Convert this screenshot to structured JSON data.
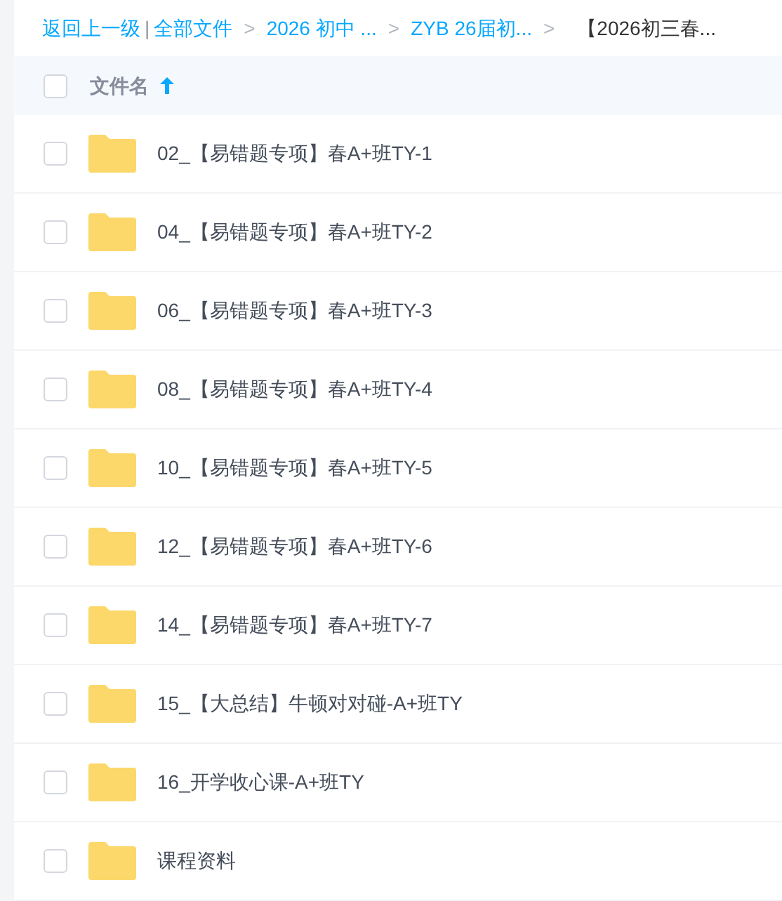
{
  "breadcrumb": {
    "back": "返回上一级",
    "divider": "|",
    "items": [
      {
        "label": "全部文件",
        "current": false
      },
      {
        "label": "2026 初中 ...",
        "current": false
      },
      {
        "label": "ZYB 26届初...",
        "current": false
      },
      {
        "label": "【2026初三春...",
        "current": true
      }
    ],
    "separator": ">"
  },
  "header": {
    "checked": false,
    "column": "文件名"
  },
  "files": [
    {
      "name": "02_【易错题专项】春A+班TY-1",
      "checked": false
    },
    {
      "name": "04_【易错题专项】春A+班TY-2",
      "checked": false
    },
    {
      "name": "06_【易错题专项】春A+班TY-3",
      "checked": false
    },
    {
      "name": "08_【易错题专项】春A+班TY-4",
      "checked": false
    },
    {
      "name": "10_【易错题专项】春A+班TY-5",
      "checked": false
    },
    {
      "name": "12_【易错题专项】春A+班TY-6",
      "checked": false
    },
    {
      "name": "14_【易错题专项】春A+班TY-7",
      "checked": false
    },
    {
      "name": "15_【大总结】牛顿对对碰-A+班TY",
      "checked": false
    },
    {
      "name": "16_开学收心课-A+班TY",
      "checked": false
    },
    {
      "name": "课程资料",
      "checked": false
    }
  ]
}
